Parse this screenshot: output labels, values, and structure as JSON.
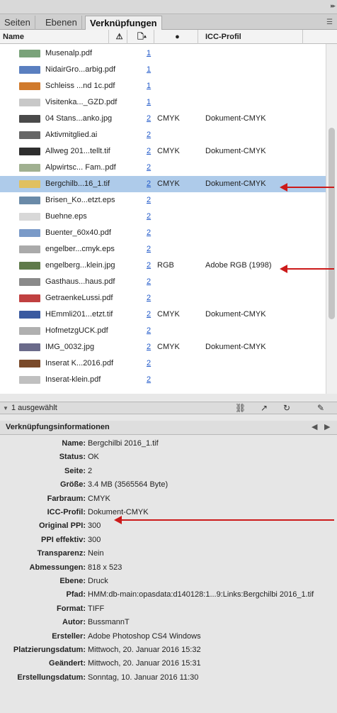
{
  "panel": {
    "tabs": [
      "Seiten",
      "Ebenen",
      "Verknüpfungen"
    ],
    "columns": {
      "name": "Name",
      "icc": "ICC-Profil"
    }
  },
  "links": [
    {
      "name": "Musenalp.pdf",
      "page": "1",
      "space": "",
      "icc": "",
      "thumb": "#7aa37a"
    },
    {
      "name": "NidairGro...arbig.pdf",
      "page": "1",
      "space": "",
      "icc": "",
      "thumb": "#5a7fc0"
    },
    {
      "name": "Schleiss ...nd 1c.pdf",
      "page": "1",
      "space": "",
      "icc": "",
      "thumb": "#d07a2c"
    },
    {
      "name": "Visitenka..._GZD.pdf",
      "page": "1",
      "space": "",
      "icc": "",
      "thumb": "#c8c8c8"
    },
    {
      "name": "04 Stans...anko.jpg",
      "page": "2",
      "space": "CMYK",
      "icc": "Dokument-CMYK",
      "thumb": "#4a4a4a"
    },
    {
      "name": "Aktivmitglied.ai",
      "page": "2",
      "space": "",
      "icc": "",
      "thumb": "#666666"
    },
    {
      "name": "Allweg 201...tellt.tif",
      "page": "2",
      "space": "CMYK",
      "icc": "Dokument-CMYK",
      "thumb": "#2e2e2e"
    },
    {
      "name": "Alpwirtsc... Fam..pdf",
      "page": "2",
      "space": "",
      "icc": "",
      "thumb": "#a0b090"
    },
    {
      "name": "Bergchilb...16_1.tif",
      "page": "2",
      "space": "CMYK",
      "icc": "Dokument-CMYK",
      "thumb": "#e0c060"
    },
    {
      "name": "Brisen_Ko...etzt.eps",
      "page": "2",
      "space": "",
      "icc": "",
      "thumb": "#6a8aa8"
    },
    {
      "name": "Buehne.eps",
      "page": "2",
      "space": "",
      "icc": "",
      "thumb": "#d8d8d8"
    },
    {
      "name": "Buenter_60x40.pdf",
      "page": "2",
      "space": "",
      "icc": "",
      "thumb": "#7a9ac8"
    },
    {
      "name": "engelber...cmyk.eps",
      "page": "2",
      "space": "",
      "icc": "",
      "thumb": "#aaaaaa"
    },
    {
      "name": "engelberg...klein.jpg",
      "page": "2",
      "space": "RGB",
      "icc": "Adobe RGB (1998)",
      "thumb": "#5f7a4a"
    },
    {
      "name": "Gasthaus...haus.pdf",
      "page": "2",
      "space": "",
      "icc": "",
      "thumb": "#8a8a8a"
    },
    {
      "name": "GetraenkeLussi.pdf",
      "page": "2",
      "space": "",
      "icc": "",
      "thumb": "#c04040"
    },
    {
      "name": "HEmmli201...etzt.tif",
      "page": "2",
      "space": "CMYK",
      "icc": "Dokument-CMYK",
      "thumb": "#3a5aa0"
    },
    {
      "name": "HofmetzgUCK.pdf",
      "page": "2",
      "space": "",
      "icc": "",
      "thumb": "#b0b0b0"
    },
    {
      "name": "IMG_0032.jpg",
      "page": "2",
      "space": "CMYK",
      "icc": "Dokument-CMYK",
      "thumb": "#6a6a8a"
    },
    {
      "name": "Inserat K...2016.pdf",
      "page": "2",
      "space": "",
      "icc": "",
      "thumb": "#7a4a2a"
    },
    {
      "name": "Inserat-klein.pdf",
      "page": "2",
      "space": "",
      "icc": "",
      "thumb": "#c0c0c0"
    }
  ],
  "selected_index": 8,
  "status": {
    "text": "1 ausgewählt"
  },
  "info": {
    "title": "Verknüpfungsinformationen",
    "rows": [
      {
        "label": "Name:",
        "value": "Bergchilbi 2016_1.tif"
      },
      {
        "label": "Status:",
        "value": "OK"
      },
      {
        "label": "Seite:",
        "value": "2"
      },
      {
        "label": "Größe:",
        "value": "3.4 MB (3565564 Byte)"
      },
      {
        "label": "Farbraum:",
        "value": "CMYK"
      },
      {
        "label": "ICC-Profil:",
        "value": "Dokument-CMYK"
      },
      {
        "label": "Original PPI:",
        "value": "300"
      },
      {
        "label": "PPI effektiv:",
        "value": "300"
      },
      {
        "label": "Transparenz:",
        "value": "Nein"
      },
      {
        "label": "Abmessungen:",
        "value": "818 x 523"
      },
      {
        "label": "Ebene:",
        "value": "Druck"
      },
      {
        "label": "Pfad:",
        "value": "HMM:db-main:opasdata:d140128:1...9:Links:Bergchilbi 2016_1.tif"
      },
      {
        "label": "Format:",
        "value": "TIFF"
      },
      {
        "label": "Autor:",
        "value": "BussmannT"
      },
      {
        "label": "Ersteller:",
        "value": "Adobe Photoshop CS4 Windows"
      },
      {
        "label": "Platzierungsdatum:",
        "value": "Mittwoch, 20. Januar 2016 15:32"
      },
      {
        "label": "Geändert:",
        "value": "Mittwoch, 20. Januar 2016 15:31"
      },
      {
        "label": "Erstellungsdatum:",
        "value": "Sonntag, 10. Januar 2016 11:30"
      }
    ]
  },
  "colors": {
    "selection": "#aecbea",
    "arrow": "#cc1a1a",
    "link": "#1f58c9"
  }
}
